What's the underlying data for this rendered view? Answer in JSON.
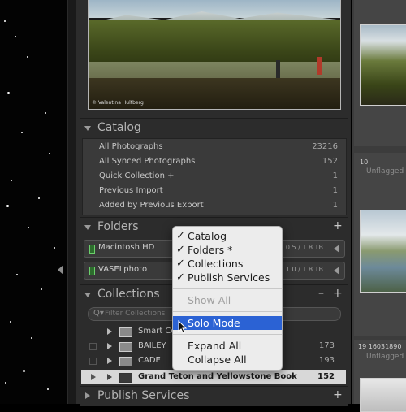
{
  "navigator": {
    "credit": "© Valentina Hultberg"
  },
  "catalog": {
    "title": "Catalog",
    "items": [
      {
        "label": "All Photographs",
        "count": "23216"
      },
      {
        "label": "All Synced Photographs",
        "count": "152"
      },
      {
        "label": "Quick Collection +",
        "count": "1"
      },
      {
        "label": "Previous Import",
        "count": "1"
      },
      {
        "label": "Added by Previous Export",
        "count": "1"
      }
    ]
  },
  "folders": {
    "title": "Folders",
    "add": "+",
    "volumes": [
      {
        "name": "Macintosh HD",
        "size": "0.5 / 1.8 TB"
      },
      {
        "name": "VASELphoto",
        "size": "1.0 / 1.8 TB"
      }
    ]
  },
  "collections": {
    "title": "Collections",
    "minus": "–",
    "add": "+",
    "filter_placeholder": "Filter Collections",
    "filter_icon": "Q▾",
    "items": [
      {
        "label": "Smart Co",
        "count": ""
      },
      {
        "label": "BAILEY",
        "count": "173"
      },
      {
        "label": "CADE",
        "count": "193"
      },
      {
        "label": "Grand Teton and Yellowstone Book",
        "count": "152"
      }
    ]
  },
  "publish": {
    "title": "Publish Services",
    "add": "+"
  },
  "menu": {
    "checked": [
      {
        "label": "Catalog"
      },
      {
        "label": "Folders *"
      },
      {
        "label": "Collections"
      },
      {
        "label": "Publish Services"
      }
    ],
    "show_all": "Show All",
    "solo_mode": "Solo Mode",
    "expand_all": "Expand All",
    "collapse_all": "Collapse All",
    "check_glyph": "✓"
  },
  "grid": {
    "cell1_number": "10",
    "cell1_flag": "Unflagged",
    "cell2_number": "19  16031890",
    "cell2_flag": "Unflagged"
  },
  "colors": {
    "menu_highlight": "#2b62d4",
    "panel_bg": "#2c2c2c",
    "volume_green": "#6bcf6b"
  }
}
